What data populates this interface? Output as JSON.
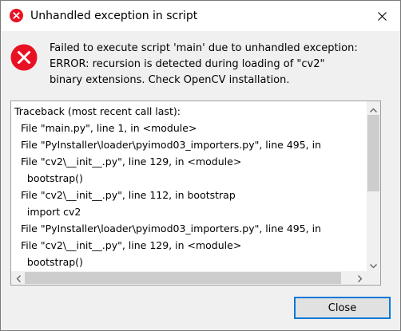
{
  "window": {
    "title": "Unhandled exception in script",
    "title_icon": "error-icon",
    "close_icon": "close-icon"
  },
  "message": {
    "icon": "error-icon",
    "lines": [
      "Failed to execute script 'main' due to unhandled exception:",
      "ERROR: recursion is detected during loading of \"cv2\"",
      "binary extensions. Check OpenCV installation."
    ]
  },
  "traceback": {
    "lines": [
      "Traceback (most recent call last):",
      "  File \"main.py\", line 1, in <module>",
      "  File \"PyInstaller\\loader\\pyimod03_importers.py\", line 495, in",
      "  File \"cv2\\__init__.py\", line 129, in <module>",
      "    bootstrap()",
      "  File \"cv2\\__init__.py\", line 112, in bootstrap",
      "    import cv2",
      "  File \"PyInstaller\\loader\\pyimod03_importers.py\", line 495, in",
      "  File \"cv2\\__init__.py\", line 129, in <module>",
      "    bootstrap()"
    ]
  },
  "buttons": {
    "close_label": "Close"
  },
  "colors": {
    "error_red": "#e81123",
    "accent": "#0078d7"
  }
}
